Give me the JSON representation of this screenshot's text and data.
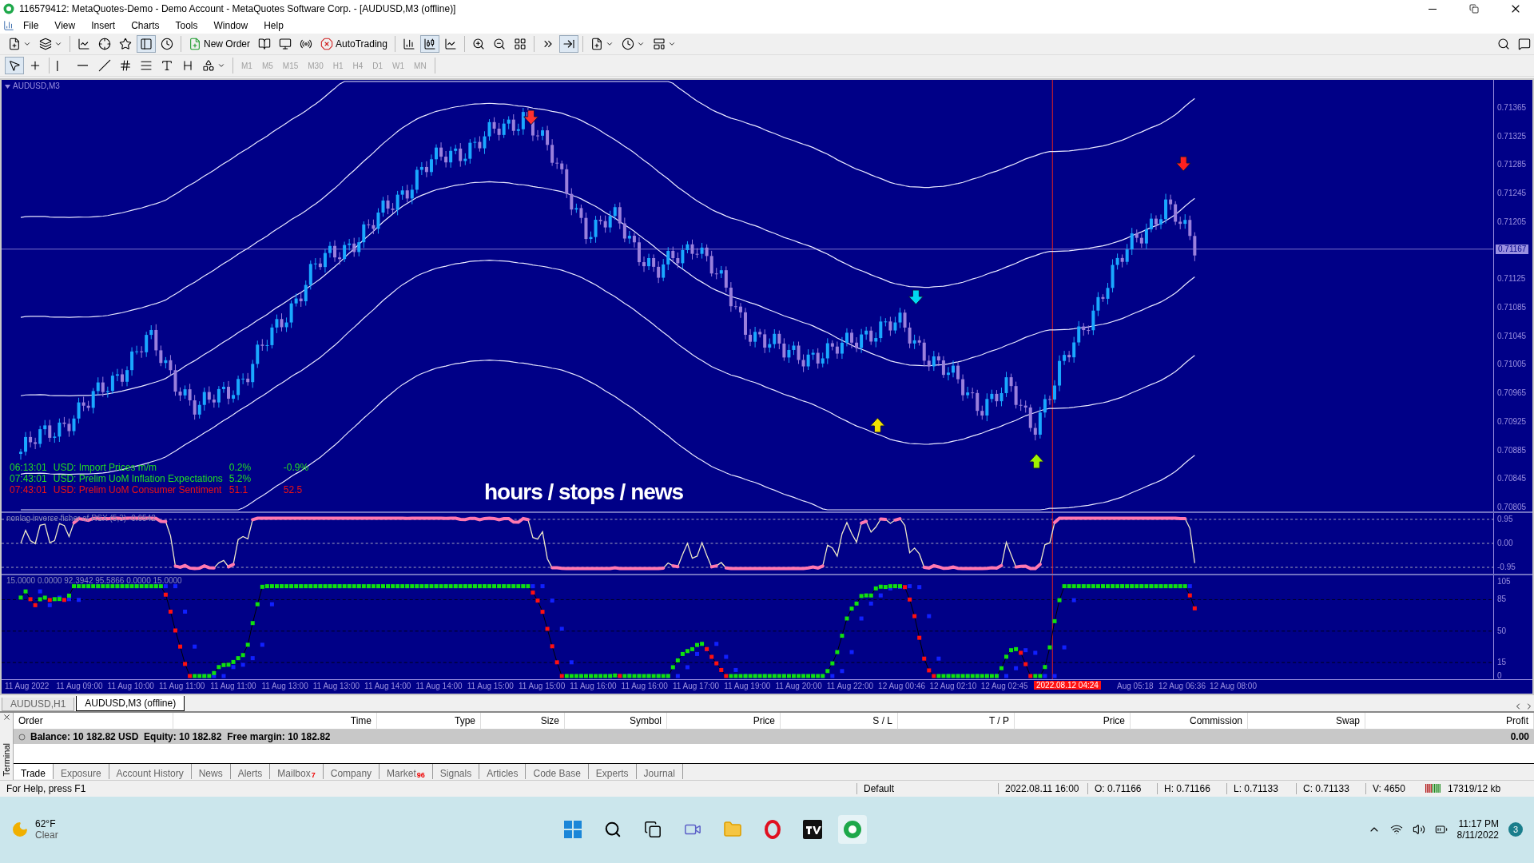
{
  "window": {
    "title": "116579412: MetaQuotes-Demo - Demo Account - MetaQuotes Software Corp. - [AUDUSD,M3 (offline)]"
  },
  "menu": [
    "File",
    "View",
    "Insert",
    "Charts",
    "Tools",
    "Window",
    "Help"
  ],
  "toolbar": {
    "new_order": "New Order",
    "autotrading": "AutoTrading"
  },
  "timeframes": [
    {
      "label": "M1",
      "disabled": true
    },
    {
      "label": "M5",
      "disabled": true
    },
    {
      "label": "M15",
      "disabled": true
    },
    {
      "label": "M30",
      "disabled": true
    },
    {
      "label": "H1",
      "disabled": true
    },
    {
      "label": "H4",
      "disabled": true
    },
    {
      "label": "D1",
      "disabled": true
    },
    {
      "label": "W1",
      "disabled": true
    },
    {
      "label": "MN",
      "disabled": true
    }
  ],
  "chart": {
    "symbol": "AUDUSD,M3",
    "price_ticks": [
      "0.71365",
      "0.71325",
      "0.71285",
      "0.71245",
      "0.71205",
      "0.71125",
      "0.71085",
      "0.71045",
      "0.71005",
      "0.70965",
      "0.70925",
      "0.70885",
      "0.70845",
      "0.70805"
    ],
    "current_price": "0.71167",
    "overlay_title": "hours / stops / news",
    "news": [
      {
        "time": "06:13:01",
        "event": "USD: Import Prices m/m",
        "values": [
          "0.2%",
          "-0.9%"
        ],
        "color": "#22dd22"
      },
      {
        "time": "07:43:01",
        "event": "USD: Prelim UoM Inflation Expectations",
        "values": [
          "5.2%"
        ],
        "color": "#22dd22"
      },
      {
        "time": "07:43:01",
        "event": "USD: Prelim UoM Consumer Sentiment",
        "values": [
          "51.1",
          "52.5"
        ],
        "color": "#ee1111"
      }
    ],
    "signals": [
      {
        "kind": "down",
        "color": "#ff3030"
      },
      {
        "kind": "down",
        "color": "#ff2020"
      },
      {
        "kind": "down",
        "color": "#00d8f0"
      },
      {
        "kind": "up",
        "color": "#f0e000"
      },
      {
        "kind": "up",
        "color": "#a0f000"
      }
    ]
  },
  "indicator_1": {
    "label": "nonlag inverse fisher of RSX (5,3) -0.6542",
    "ticks": [
      "0.95",
      "0.00",
      "-0.95"
    ]
  },
  "indicator_2": {
    "label": "15.0000 0.0000 92.3942 95.5866 0.0000 15.0000",
    "ticks": [
      "105",
      "85",
      "50",
      "15",
      "0"
    ]
  },
  "time_axis": {
    "labels": [
      "11 Aug 2022",
      "11 Aug 09:00",
      "11 Aug 10:00",
      "11 Aug 11:00",
      "11 Aug 11:00",
      "11 Aug 13:00",
      "11 Aug 13:00",
      "11 Aug 14:00",
      "11 Aug 14:00",
      "11 Aug 15:00",
      "11 Aug 15:00",
      "11 Aug 16:00",
      "11 Aug 16:00",
      "11 Aug 17:00",
      "11 Aug 19:00",
      "11 Aug 20:00",
      "11 Aug 22:00",
      "12 Aug 00:46",
      "12 Aug 02:10",
      "12 Aug 02:45",
      "Aug 05:18",
      "12 Aug 06:36",
      "12 Aug 08:00"
    ],
    "cursor": "2022.08.12 04:24"
  },
  "chart_tabs": [
    {
      "label": "AUDUSD,H1",
      "selected": false
    },
    {
      "label": "AUDUSD,M3 (offline)",
      "selected": true
    }
  ],
  "terminal": {
    "side_label": "Terminal",
    "columns": [
      "Order",
      "Time",
      "Type",
      "Size",
      "Symbol",
      "Price",
      "S / L",
      "T / P",
      "Price",
      "Commission",
      "Swap",
      "Profit"
    ],
    "balance": "Balance: 10 182.82 USD  Equity: 10 182.82  Free margin: 10 182.82",
    "profit": "0.00",
    "tabs": [
      {
        "label": "Trade",
        "selected": true
      },
      {
        "label": "Exposure",
        "selected": false
      },
      {
        "label": "Account History",
        "selected": false
      },
      {
        "label": "News",
        "selected": false
      },
      {
        "label": "Alerts",
        "selected": false
      },
      {
        "label": "Mailbox",
        "badge": "7",
        "selected": false
      },
      {
        "label": "Company",
        "selected": false
      },
      {
        "label": "Market",
        "badge": "96",
        "selected": false
      },
      {
        "label": "Signals",
        "selected": false
      },
      {
        "label": "Articles",
        "selected": false
      },
      {
        "label": "Code Base",
        "selected": false
      },
      {
        "label": "Experts",
        "selected": false
      },
      {
        "label": "Journal",
        "selected": false
      }
    ]
  },
  "status_bar": {
    "help": "For Help, press F1",
    "profile": "Default",
    "datetime": "2022.08.11 16:00",
    "open": "O: 0.71166",
    "high": "H: 0.71166",
    "low": "L: 0.71133",
    "close": "C: 0.71133",
    "volume": "V: 4650",
    "traffic": "17319/12 kb"
  },
  "taskbar": {
    "temperature": "62°F",
    "weather": "Clear",
    "time": "11:17 PM",
    "date": "8/11/2022",
    "notifications": "3"
  }
}
